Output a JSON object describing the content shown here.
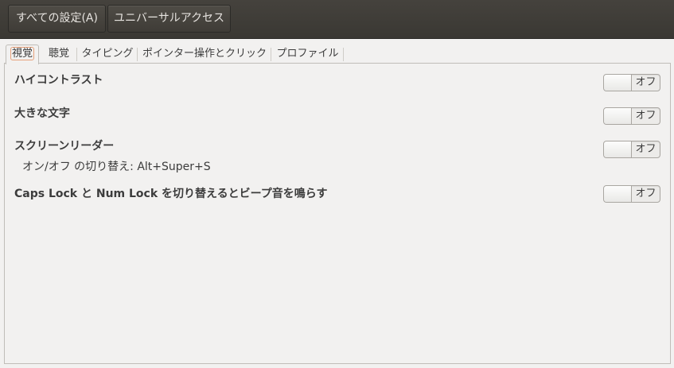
{
  "header": {
    "all_settings": "すべての設定(A)",
    "universal_access": "ユニバーサルアクセス"
  },
  "tabs": [
    {
      "label": "視覚",
      "active": true
    },
    {
      "label": "聴覚",
      "active": false
    },
    {
      "label": "タイピング",
      "active": false
    },
    {
      "label": "ポインター操作とクリック",
      "active": false
    },
    {
      "label": "プロファイル",
      "active": false
    }
  ],
  "settings": [
    {
      "title": "ハイコントラスト",
      "toggle": "オフ",
      "state": false
    },
    {
      "title": "大きな文字",
      "toggle": "オフ",
      "state": false
    },
    {
      "title": "スクリーンリーダー",
      "subtitle": "オン/オフ の切り替え:  Alt+Super+S",
      "toggle": "オフ",
      "state": false
    },
    {
      "title": "Caps Lock と Num Lock を切り替えるとビープ音を鳴らす",
      "toggle": "オフ",
      "state": false
    }
  ],
  "colors": {
    "header_bg": "#3c3b37",
    "window_bg": "#f2f1f0",
    "accent_focus": "#e7a27c"
  }
}
